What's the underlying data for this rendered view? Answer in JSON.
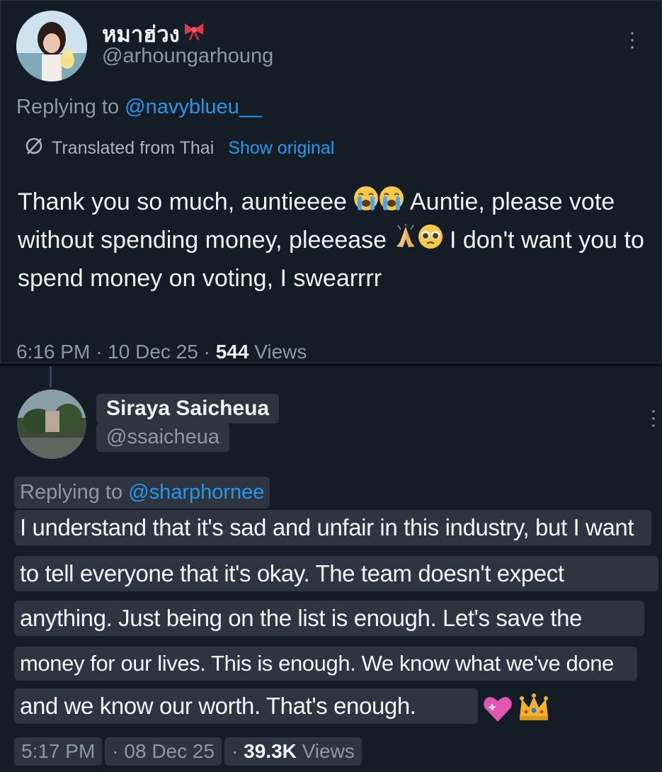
{
  "tweet1": {
    "display_name": "หมาฮ่วง",
    "handle": "@arhoungarhoung",
    "replying_prefix": "Replying to",
    "replying_to": "@navyblueu__",
    "translated_label": "Translated from Thai",
    "show_original": "Show original",
    "body_1": "Thank you so much, auntieeee",
    "body_2": "Auntie, please vote without spending money, pleeease",
    "body_3": "I don't want you to spend money on voting, I swearrrr",
    "time": "6:16 PM",
    "date": "10 Dec 25",
    "views_count": "544",
    "views_label": "Views"
  },
  "tweet2": {
    "display_name": "Siraya Saicheua",
    "handle": "@ssaicheua",
    "replying_prefix": "Replying to",
    "replying_to": "@sharphornee",
    "lines": [
      "I understand that it's sad and unfair in this industry, but I want",
      "to tell everyone that it's okay. The team doesn't expect",
      "anything. Just being on the list is enough. Let's save the",
      "money for our lives. This is enough. We know what we've done",
      "and we know our worth. That's enough."
    ],
    "time": "5:17 PM",
    "date": "08 Dec 25",
    "views_count": "39.3K",
    "views_label": "Views"
  },
  "icons": [
    "ribbon-icon",
    "more-icon",
    "translate-icon",
    "crying-face-icon",
    "pleading-face-icon",
    "folded-hands-icon",
    "sparkling-heart-icon",
    "crown-icon"
  ],
  "colors": {
    "background": "#141c26",
    "accent": "#1d9bf0",
    "muted": "#8b98a5",
    "highlight": "#2e3540"
  }
}
